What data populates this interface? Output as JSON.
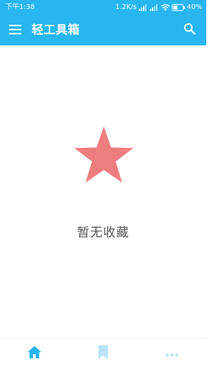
{
  "status_bar": {
    "time": "下午1:38",
    "network_speed": "1.2K/s",
    "battery_percent": "40%"
  },
  "toolbar": {
    "title": "轻工具箱",
    "menu_icon": "hamburger-menu-icon",
    "search_icon": "search-icon"
  },
  "empty_state": {
    "icon": "star-icon",
    "message": "暂无收藏"
  },
  "bottom_nav": {
    "items": [
      {
        "icon": "home-icon",
        "active": true
      },
      {
        "icon": "bookmark-icon",
        "active": false
      },
      {
        "icon": "more-icon",
        "active": false
      }
    ]
  },
  "colors": {
    "accent": "#27b6f0",
    "star": "#ee7d80",
    "nav_inactive": "#b9e4f8"
  }
}
